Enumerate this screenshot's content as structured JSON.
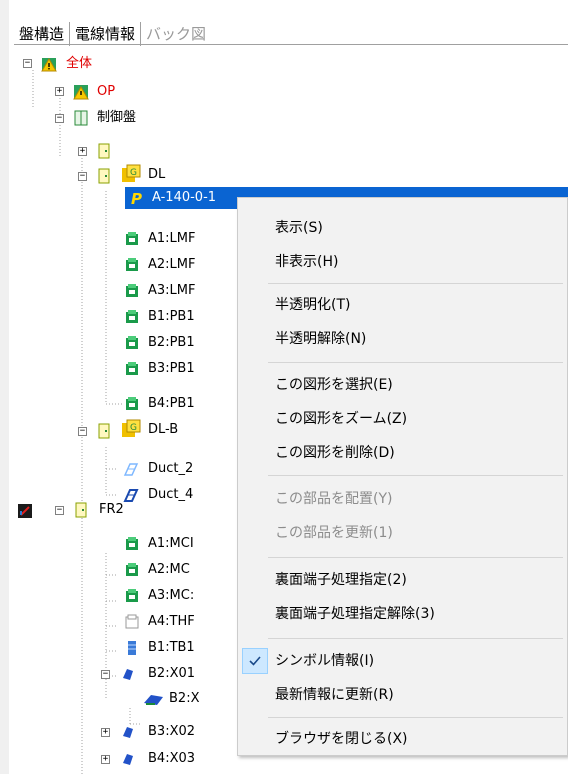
{
  "tabs": [
    {
      "label": "盤構造",
      "state": "active"
    },
    {
      "label": "電線情報",
      "state": "normal"
    },
    {
      "label": "バック図",
      "state": "disabled"
    }
  ],
  "tree": {
    "root": "全体",
    "op": "OP",
    "control_panel": "制御盤",
    "dl": "DL",
    "selected": "A-140-0-1",
    "dl_children": [
      "A1:LMF",
      "A2:LMF",
      "A3:LMF",
      "B1:PB1",
      "B2:PB1",
      "B3:PB1",
      "B4:PB1"
    ],
    "dlb": "DL-B",
    "dlb_children": [
      "Duct_2",
      "Duct_4"
    ],
    "fr2": "FR2",
    "fr2_children": [
      "A1:MCI",
      "A2:MC",
      "A3:MC:",
      "A4:THF",
      "B1:TB1",
      "B2:X01"
    ],
    "b2_child": "B2:X",
    "b3": "B3:X02",
    "b4": "B4:X03"
  },
  "context_menu": {
    "items": [
      {
        "label": "表示(S)",
        "enabled": true
      },
      {
        "label": "非表示(H)",
        "enabled": true
      },
      {
        "label": "半透明化(T)",
        "enabled": true
      },
      {
        "label": "半透明解除(N)",
        "enabled": true
      },
      {
        "label": "この図形を選択(E)",
        "enabled": true
      },
      {
        "label": "この図形をズーム(Z)",
        "enabled": true
      },
      {
        "label": "この図形を削除(D)",
        "enabled": true
      },
      {
        "label": "この部品を配置(Y)",
        "enabled": false
      },
      {
        "label": "この部品を更新(1)",
        "enabled": false
      },
      {
        "label": "裏面端子処理指定(2)",
        "enabled": true
      },
      {
        "label": "裏面端子処理指定解除(3)",
        "enabled": true
      },
      {
        "label": "シンボル情報(I)",
        "enabled": true,
        "checked": true
      },
      {
        "label": "最新情報に更新(R)",
        "enabled": true
      },
      {
        "label": "ブラウザを閉じる(X)",
        "enabled": true
      }
    ]
  },
  "colors": {
    "selection": "#0a64d2",
    "root_text": "#e00000",
    "menu_bg": "#f2f2f2",
    "check_highlight": "#cde8ff"
  }
}
